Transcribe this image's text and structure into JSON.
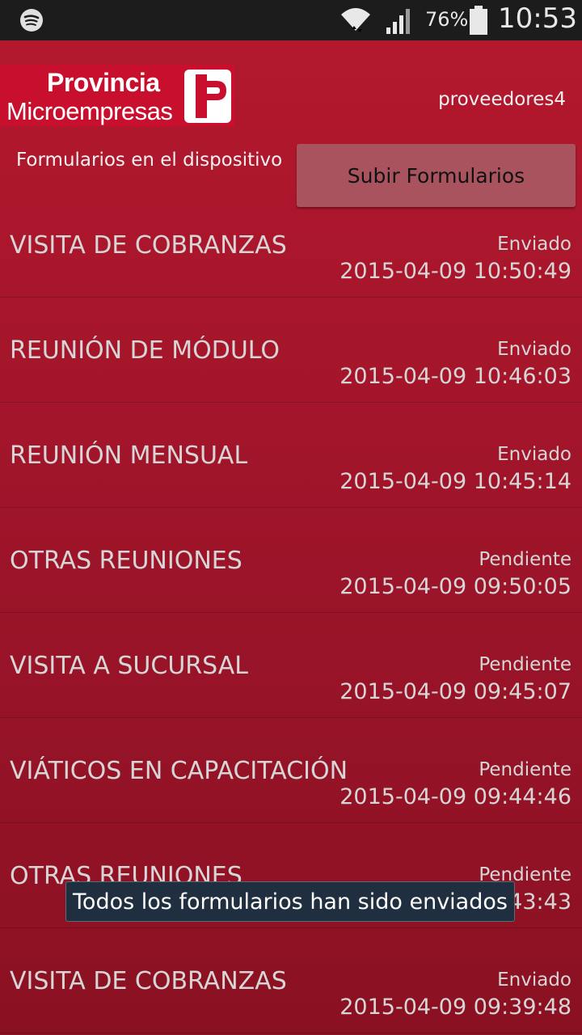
{
  "status_bar": {
    "battery_percent": "76%",
    "time": "10:53",
    "icons": [
      "spotify-icon",
      "wifi-icon",
      "signal-icon",
      "battery-icon"
    ]
  },
  "header": {
    "logo_line1": "Provincia",
    "logo_line2": "Microempresas",
    "username": "proveedores4"
  },
  "toolbar": {
    "subtitle": "Formularios en el dispositivo",
    "upload_label": "Subir Formularios"
  },
  "forms": [
    {
      "title": "VISITA DE COBRANZAS",
      "status": "Enviado",
      "date": "2015-04-09 10:50:49"
    },
    {
      "title": "REUNIÓN DE MÓDULO",
      "status": "Enviado",
      "date": "2015-04-09 10:46:03"
    },
    {
      "title": "REUNIÓN MENSUAL",
      "status": "Enviado",
      "date": "2015-04-09 10:45:14"
    },
    {
      "title": "OTRAS REUNIONES",
      "status": "Pendiente",
      "date": "2015-04-09 09:50:05"
    },
    {
      "title": "VISITA A SUCURSAL",
      "status": "Pendiente",
      "date": "2015-04-09 09:45:07"
    },
    {
      "title": "VIÁTICOS EN CAPACITACIÓN",
      "status": "Pendiente",
      "date": "2015-04-09 09:44:46"
    },
    {
      "title": "OTRAS REUNIONES",
      "status": "Pendiente",
      "date": "2015-04-09 09:43:43"
    },
    {
      "title": "VISITA DE COBRANZAS",
      "status": "Enviado",
      "date": "2015-04-09 09:39:48"
    }
  ],
  "toast": {
    "message": "Todos los formularios han sido enviados"
  },
  "colors": {
    "brand_red": "#c8102e",
    "background": "#a3162b",
    "button": "#a8535e"
  }
}
